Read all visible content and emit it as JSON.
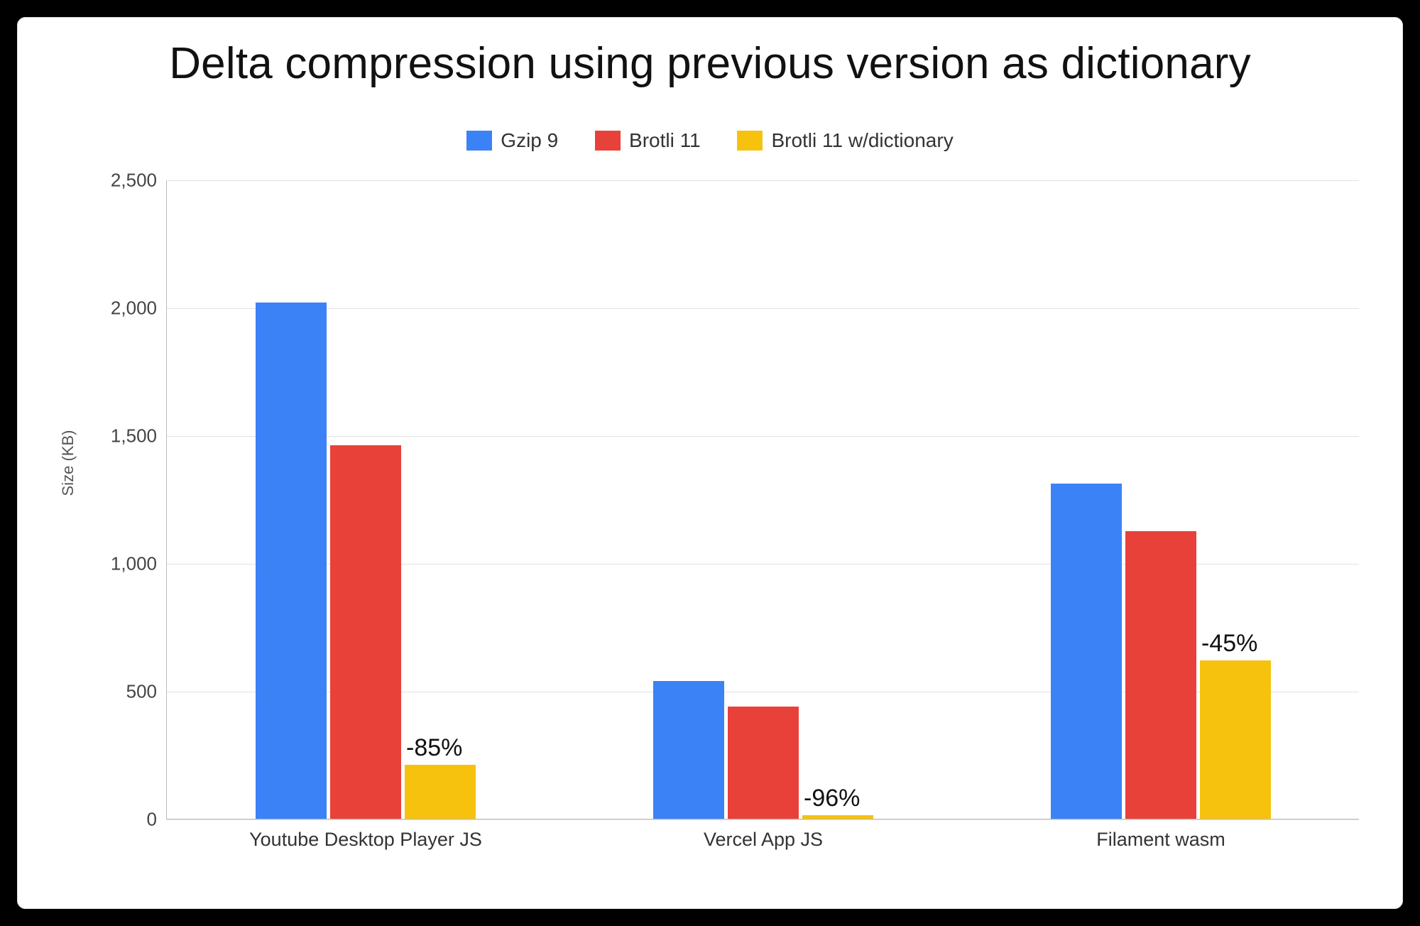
{
  "chart_data": {
    "type": "bar",
    "title": "Delta compression using previous version as dictionary",
    "ylabel": "Size (KB)",
    "xlabel": "",
    "ylim": [
      0,
      2500
    ],
    "y_ticks": [
      "0",
      "500",
      "1,000",
      "1,500",
      "2,000",
      "2,500"
    ],
    "categories": [
      "Youtube Desktop Player JS",
      "Vercel App JS",
      "Filament wasm"
    ],
    "series": [
      {
        "name": "Gzip 9",
        "color": "#3b82f6",
        "values": [
          2020,
          540,
          1310
        ]
      },
      {
        "name": "Brotli 11",
        "color": "#e8413a",
        "values": [
          1460,
          440,
          1125
        ]
      },
      {
        "name": "Brotli 11 w/dictionary",
        "color": "#f6c20e",
        "values": [
          210,
          15,
          620
        ]
      }
    ],
    "annotations": [
      {
        "category_index": 0,
        "series_index": 2,
        "text": "-85%"
      },
      {
        "category_index": 1,
        "series_index": 2,
        "text": "-96%"
      },
      {
        "category_index": 2,
        "series_index": 2,
        "text": "-45%"
      }
    ]
  }
}
